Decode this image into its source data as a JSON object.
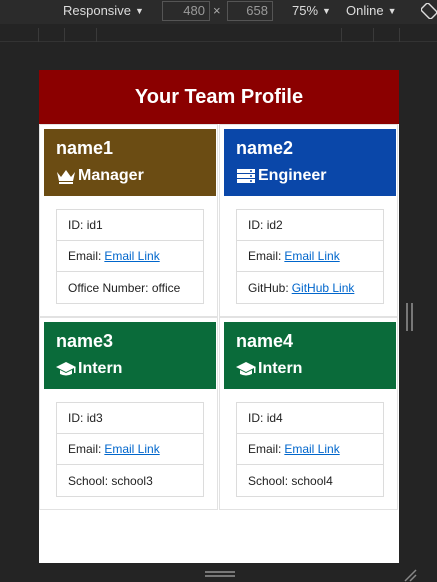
{
  "devtools": {
    "device": "Responsive",
    "width": "480",
    "height": "658",
    "times": "×",
    "zoom": "75%",
    "network": "Online"
  },
  "page": {
    "title": "Your Team Profile",
    "members": [
      {
        "name": "name1",
        "role": "Manager",
        "role_icon": "crown-icon",
        "color": "#6b4c13",
        "id_label": "ID: ",
        "id": "id1",
        "email_label": "Email:",
        "email_link": "Email Link",
        "extra_label": "Office Number: ",
        "extra_value": "office",
        "extra_is_link": false
      },
      {
        "name": "name2",
        "role": "Engineer",
        "role_icon": "server-icon",
        "color": "#0a47a9",
        "id_label": "ID: ",
        "id": "id2",
        "email_label": "Email:",
        "email_link": "Email Link",
        "extra_label": "GitHub:",
        "extra_value": "GitHub Link",
        "extra_is_link": true
      },
      {
        "name": "name3",
        "role": "Intern",
        "role_icon": "graduation-cap-icon",
        "color": "#0a6b3a",
        "id_label": "ID: ",
        "id": "id3",
        "email_label": "Email:",
        "email_link": "Email Link",
        "extra_label": "School: ",
        "extra_value": "school3",
        "extra_is_link": false
      },
      {
        "name": "name4",
        "role": "Intern",
        "role_icon": "graduation-cap-icon",
        "color": "#0a6b3a",
        "id_label": "ID: ",
        "id": "id4",
        "email_label": "Email:",
        "email_link": "Email Link",
        "extra_label": "School: ",
        "extra_value": "school4",
        "extra_is_link": false
      }
    ]
  },
  "colors": {
    "header": "#8b0000",
    "link": "#0066cc"
  }
}
